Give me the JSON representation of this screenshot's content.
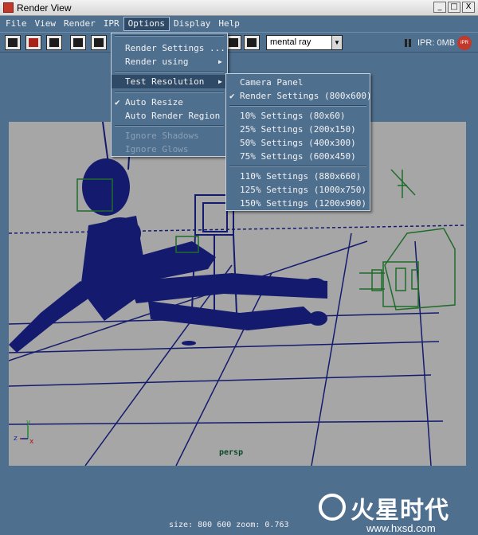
{
  "window": {
    "title": "Render View"
  },
  "window_buttons": [
    "_",
    "□",
    "X"
  ],
  "menubar": [
    "File",
    "View",
    "Render",
    "IPR",
    "Options",
    "Display",
    "Help"
  ],
  "toolbar": {
    "renderer": "mental ray",
    "ipr_memory": "IPR: 0MB",
    "ipr_badge": "IPR"
  },
  "options_menu": {
    "render_settings": "Render Settings ...",
    "render_using": "Render using",
    "test_resolution": "Test Resolution",
    "auto_resize": "Auto Resize",
    "auto_render_region": "Auto Render Region",
    "ignore_shadows": "Ignore Shadows",
    "ignore_glows": "Ignore Glows",
    "auto_resize_checked": true
  },
  "test_resolution_menu": {
    "camera_panel": "Camera Panel",
    "render_settings": "Render Settings  (800x600)",
    "p10": "10% Settings  (80x60)",
    "p25": "25% Settings  (200x150)",
    "p50": "50% Settings  (400x300)",
    "p75": "75% Settings  (600x450)",
    "p110": "110% Settings  (880x660)",
    "p125": "125% Settings  (1000x750)",
    "p150": "150% Settings  (1200x900)",
    "selected": "Render Settings"
  },
  "viewport": {
    "camera": "persp",
    "axis_labels": [
      "y",
      "z",
      "x"
    ]
  },
  "status": {
    "text": "size:  800  600 zoom: 0.763"
  },
  "watermark": {
    "brand": "火星时代",
    "url": "www.hxsd.com"
  },
  "colors": {
    "ui_bg": "#4f6f8f",
    "viewport_bg": "#a6a6a6",
    "wire_blue": "#141a6e",
    "wire_green": "#1f6b2a"
  }
}
